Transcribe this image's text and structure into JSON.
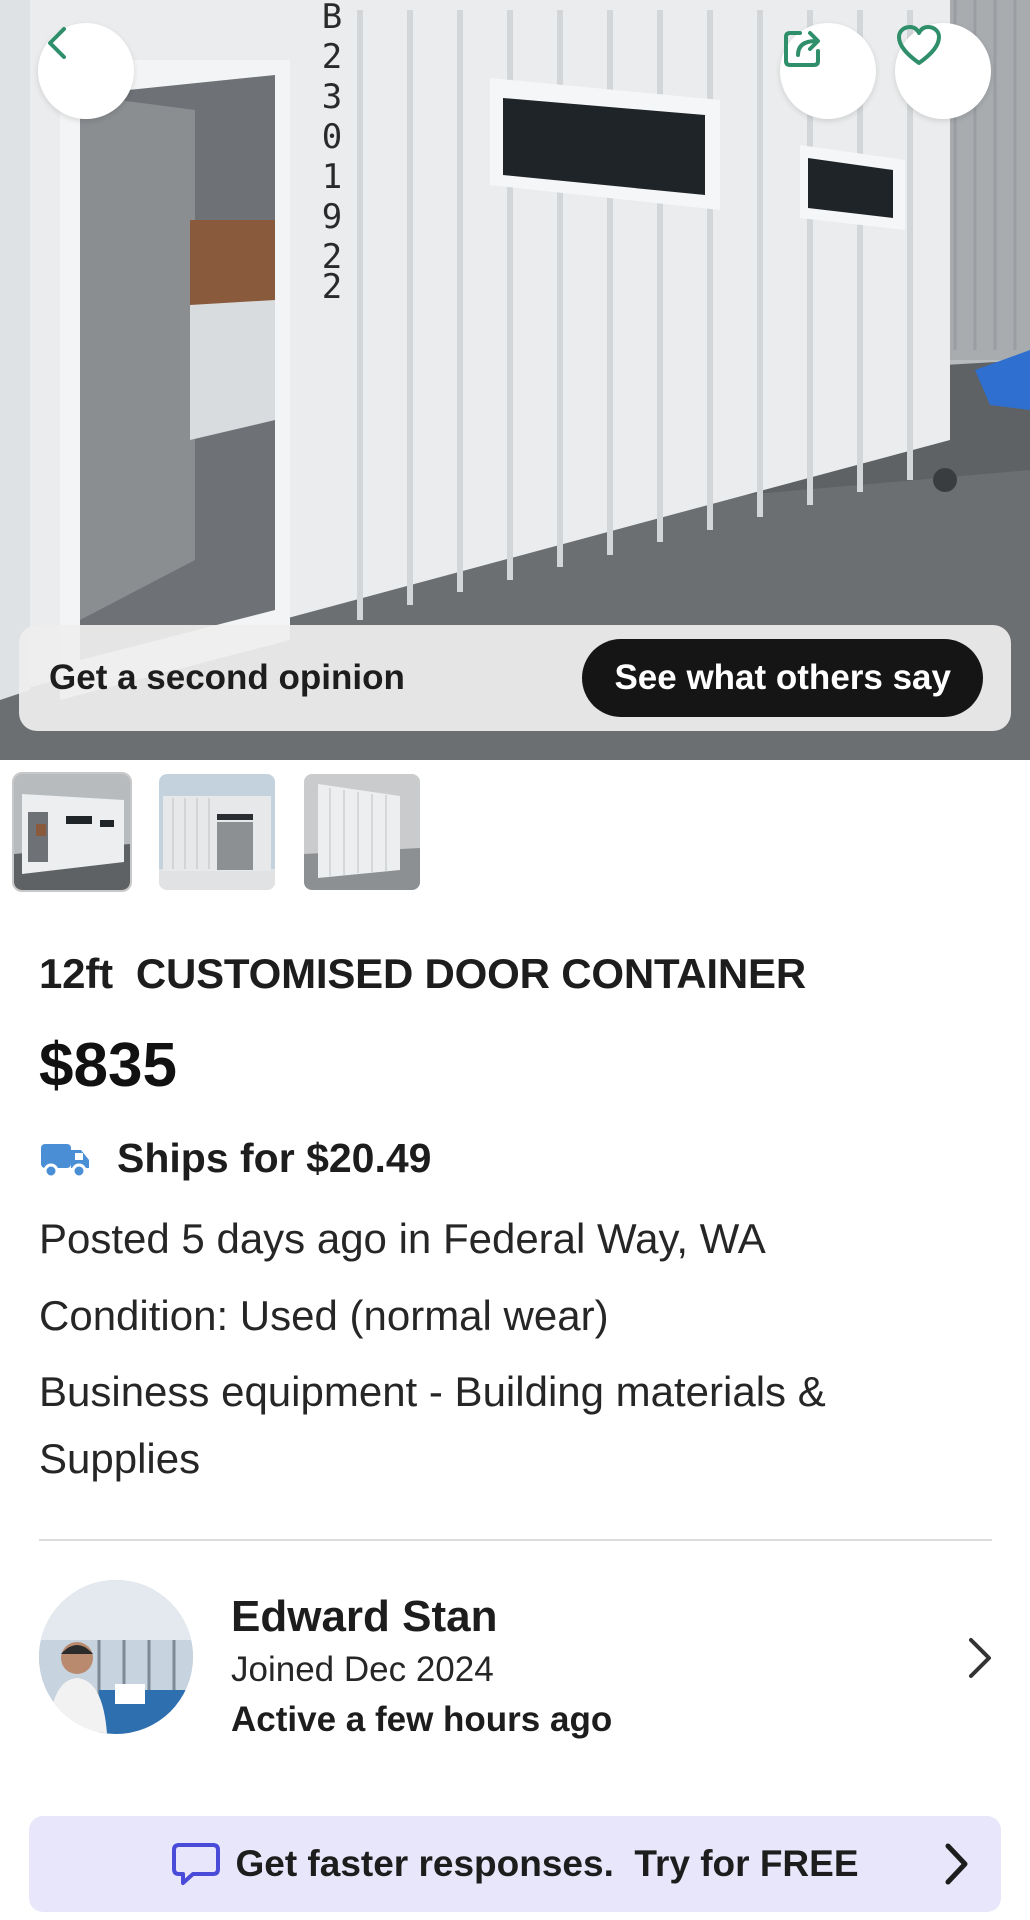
{
  "colors": {
    "accent_green": "#2f8f6b",
    "truck_blue": "#4a8fd6",
    "promo_bg": "#e7e6fa",
    "promo_icon": "#4b4bd9",
    "dark_button": "#151515"
  },
  "header": {
    "back_icon": "chevron-left-icon",
    "share_icon": "share-icon",
    "favorite_icon": "heart-icon"
  },
  "opinion_bar": {
    "text": "Get a second opinion",
    "button_label": "See what others say"
  },
  "thumbnails": [
    {
      "name": "container-side-view",
      "selected": true
    },
    {
      "name": "container-window-view",
      "selected": false
    },
    {
      "name": "container-end-view",
      "selected": false
    }
  ],
  "listing": {
    "title": "12ft  CUSTOMISED DOOR CONTAINER",
    "price": "$835",
    "shipping_icon": "truck-icon",
    "shipping": "Ships for $20.49",
    "posted": "Posted 5 days ago in Federal Way, WA",
    "condition": "Condition: Used (normal wear)",
    "category": "Business equipment - Building materials & Supplies"
  },
  "seller": {
    "name": "Edward Stan",
    "joined": "Joined Dec 2024",
    "active": "Active a few hours ago"
  },
  "promo": {
    "icon": "chat-bubble-icon",
    "text": "Get faster responses.  Try for FREE"
  }
}
